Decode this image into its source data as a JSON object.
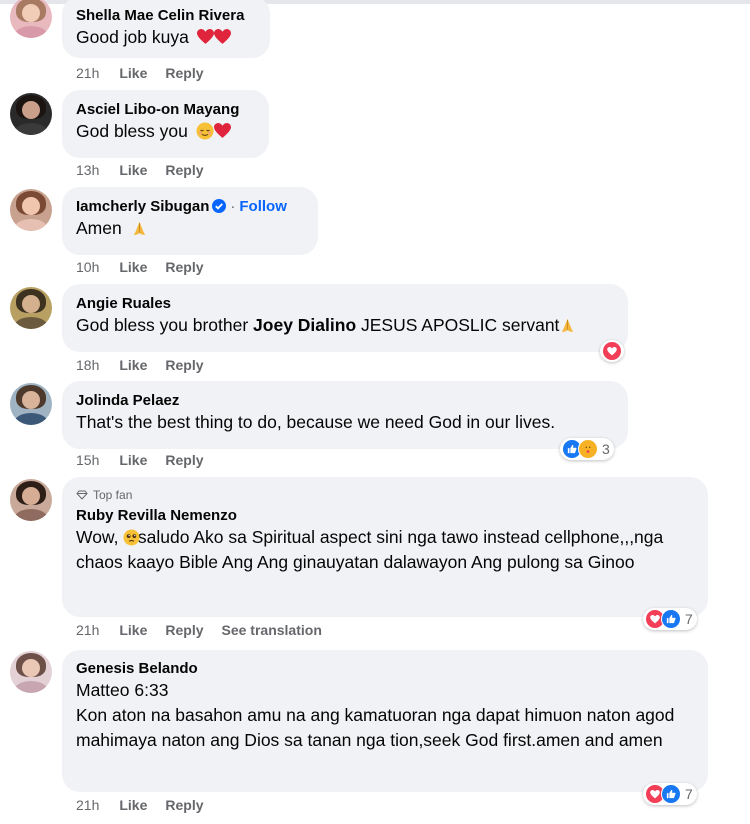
{
  "actions": {
    "like": "Like",
    "reply": "Reply",
    "see_translation": "See translation"
  },
  "colors": {
    "heart": "#f33e58",
    "like": "#1877f2",
    "link": "#0866ff",
    "meta": "#65676b",
    "bubble": "#f0f2f5"
  },
  "comments": [
    {
      "name": "Shella Mae Celin Rivera",
      "text": "Good job kuya",
      "emoji": "two red hearts",
      "time": "21h"
    },
    {
      "name": "Asciel Libo-on Mayang",
      "text": "God bless you",
      "emoji": "relieved face and red heart",
      "time": "13h"
    },
    {
      "name": "Iamcherly Sibugan",
      "follow": "Follow",
      "text": "Amen",
      "emoji": "folded hands",
      "time": "10h"
    },
    {
      "name": "Angie Ruales",
      "text_pre": "God bless you brother ",
      "mention": "Joey Dialino",
      "text_post": " JESUS APOSLIC servant",
      "time": "18h"
    },
    {
      "name": "Jolinda Pelaez",
      "text": "That's the best thing to do, because we need God in our lives.",
      "time": "15h",
      "reaction_count": "3"
    },
    {
      "badge": "Top fan",
      "name": "Ruby Revilla Nemenzo",
      "text": "Wow,    saludo Ako sa Spiritual aspect sini nga tawo instead cellphone,,,nga chaos kaayo Bible Ang Ang ginauyatan dalawayon Ang pulong sa Ginoo",
      "time": "21h",
      "reaction_count": "7"
    },
    {
      "name": "Genesis Belando",
      "line1": "Matteo 6:33",
      "text": "Kon aton na basahon amu na ang kamatuoran nga dapat himuon naton agod mahimaya naton ang Dios sa tanan nga tion,seek God first.amen and amen",
      "time": "21h",
      "reaction_count": "7"
    }
  ]
}
